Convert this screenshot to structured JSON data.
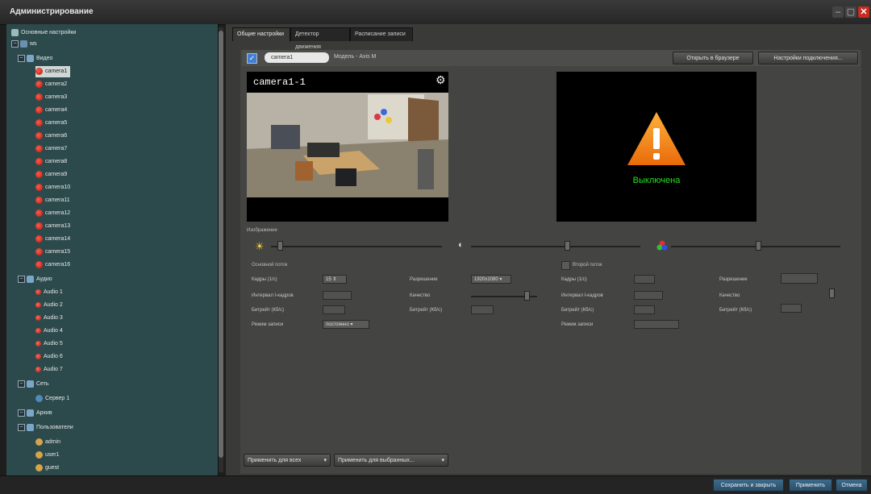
{
  "window": {
    "title": "Администрирование"
  },
  "tree": [
    {
      "label": "Основные настройки",
      "icon": "wrench-icon",
      "type": "root"
    },
    {
      "label": "ws",
      "icon": "server-icon",
      "type": "server"
    },
    {
      "label": "Видео",
      "icon": "folder-icon",
      "type": "group"
    },
    {
      "label": "camera1",
      "icon": "camera-icon",
      "type": "cam",
      "selected": true
    },
    {
      "label": "camera2",
      "icon": "camera-icon",
      "type": "cam"
    },
    {
      "label": "camera3",
      "icon": "camera-icon",
      "type": "cam"
    },
    {
      "label": "camera4",
      "icon": "camera-icon",
      "type": "cam"
    },
    {
      "label": "camera5",
      "icon": "camera-icon",
      "type": "cam"
    },
    {
      "label": "camera6",
      "icon": "camera-icon",
      "type": "cam"
    },
    {
      "label": "camera7",
      "icon": "camera-icon",
      "type": "cam"
    },
    {
      "label": "camera8",
      "icon": "camera-icon",
      "type": "cam"
    },
    {
      "label": "camera9",
      "icon": "camera-icon",
      "type": "cam"
    },
    {
      "label": "camera10",
      "icon": "camera-icon",
      "type": "cam"
    },
    {
      "label": "camera11",
      "icon": "camera-icon",
      "type": "cam"
    },
    {
      "label": "camera12",
      "icon": "camera-icon",
      "type": "cam"
    },
    {
      "label": "camera13",
      "icon": "camera-icon",
      "type": "cam"
    },
    {
      "label": "camera14",
      "icon": "camera-icon",
      "type": "cam"
    },
    {
      "label": "camera15",
      "icon": "camera-icon",
      "type": "cam"
    },
    {
      "label": "camera16",
      "icon": "camera-icon",
      "type": "cam"
    },
    {
      "label": "Аудио",
      "icon": "mic-icon",
      "type": "group"
    },
    {
      "label": "Audio 1",
      "icon": "mic-icon",
      "type": "mic"
    },
    {
      "label": "Audio 2",
      "icon": "mic-icon",
      "type": "mic"
    },
    {
      "label": "Audio 3",
      "icon": "mic-icon",
      "type": "mic"
    },
    {
      "label": "Audio 4",
      "icon": "mic-icon",
      "type": "mic"
    },
    {
      "label": "Audio 5",
      "icon": "mic-icon",
      "type": "mic"
    },
    {
      "label": "Audio 6",
      "icon": "mic-icon",
      "type": "mic"
    },
    {
      "label": "Audio 7",
      "icon": "mic-icon",
      "type": "mic"
    },
    {
      "label": "Сеть",
      "icon": "network-icon",
      "type": "group"
    },
    {
      "label": "Сервер 1",
      "icon": "network-node-icon",
      "type": "net"
    },
    {
      "label": "Архив",
      "icon": "archive-icon",
      "type": "group"
    },
    {
      "label": "Пользователи",
      "icon": "users-icon",
      "type": "group"
    },
    {
      "label": "admin",
      "icon": "user-icon",
      "type": "user"
    },
    {
      "label": "user1",
      "icon": "user-icon",
      "type": "user"
    },
    {
      "label": "guest",
      "icon": "user-icon",
      "type": "user"
    }
  ],
  "tabs": [
    "Общие настройки",
    "Детектор движения",
    "Расписание записи"
  ],
  "device": {
    "enabled_mark": "✓",
    "name": "camera1",
    "model_label": "Модель - Axis M",
    "open_browser_label": "Открыть в браузере",
    "connection_settings_label": "Настройки подключения..."
  },
  "preview": {
    "camera_name": "camera1-1"
  },
  "offline": {
    "status_text": "Выключена",
    "status_color": "#24e024"
  },
  "image_settings": {
    "section_label": "Изображение",
    "brightness_icon": "sun-icon",
    "contrast_icon": "contrast-icon",
    "color_icon": "rgb-icon",
    "brightness_level": 0.04,
    "contrast_level": 0.55,
    "saturation_level": 0.5
  },
  "primary_stream": {
    "label": "Основной поток",
    "fps_label": "Кадры (1/с)",
    "fps_value": "15",
    "keyframe_label": "Интервал I-кадров",
    "keyframe_value": "",
    "bitrate_label": "Битрейт (Кб/с)",
    "bitrate_value": "",
    "codec_label": "Режим записи",
    "codec_value": "постоянно",
    "resolution_label": "Разрешение",
    "resolution_value": "1920x1080",
    "quality_label": "Качество",
    "quality_level": 0.8,
    "bitrate2_label": "Битрейт (Кб/с)",
    "bitrate2_value": ""
  },
  "secondary_stream": {
    "label": "Второй поток",
    "fps_label": "Кадры (1/с)",
    "fps_value": "",
    "keyframe_label": "Интервал I-кадров",
    "keyframe_value": "",
    "bitrate_label": "Битрейт (Кб/с)",
    "bitrate_value": "",
    "mode_label": "Режим записи",
    "mode_value": "",
    "resolution_label": "Разрешение",
    "resolution_value": "",
    "quality_label": "Качество",
    "bitrate2_label": "Битрейт (Кб/с)",
    "bitrate2_value": ""
  },
  "apply_buttons": {
    "apply_all": "Применить для всех",
    "apply_selected": "Применить для выбранных..."
  },
  "footer": {
    "save_close": "Сохранить и закрыть",
    "apply": "Применить",
    "cancel": "Отмена"
  },
  "colors": {
    "accent": "#3f7fd6",
    "sidebar_bg": "#2c4a4c",
    "warning": "#f5a020"
  }
}
